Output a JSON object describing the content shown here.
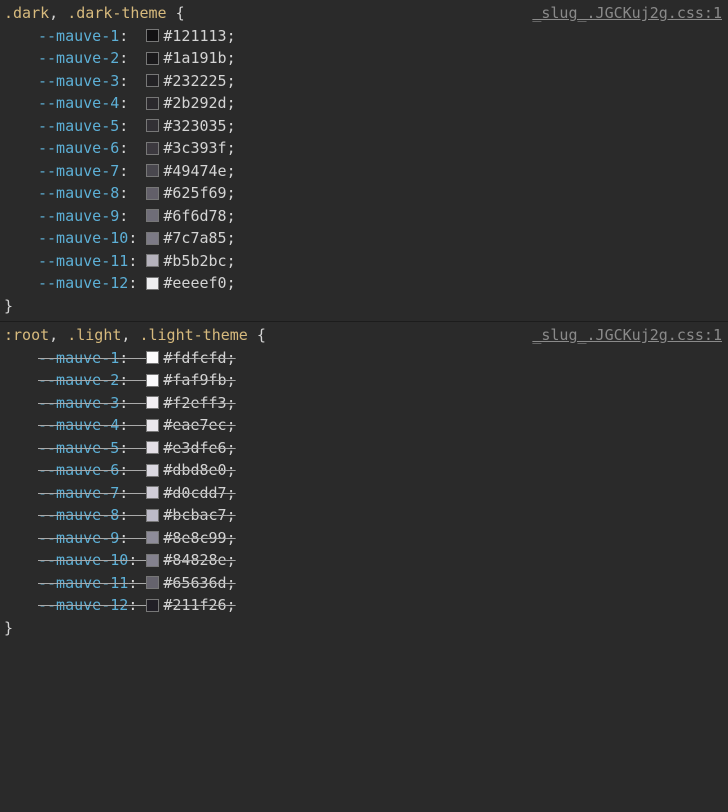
{
  "rules": [
    {
      "selector_parts": [
        {
          "t": ".dark",
          "c": "sel-class"
        },
        {
          "t": ", ",
          "c": "sel-punc"
        },
        {
          "t": ".dark-theme",
          "c": "sel-class"
        },
        {
          "t": " {",
          "c": "sel-punc"
        }
      ],
      "source": "_slug_.JGCKuj2g.css:1",
      "overridden": false,
      "decls": [
        {
          "name": "--mauve-1",
          "pad": " ",
          "value": "#121113",
          "swatch": "#121113"
        },
        {
          "name": "--mauve-2",
          "pad": " ",
          "value": "#1a191b",
          "swatch": "#1a191b"
        },
        {
          "name": "--mauve-3",
          "pad": " ",
          "value": "#232225",
          "swatch": "#232225"
        },
        {
          "name": "--mauve-4",
          "pad": " ",
          "value": "#2b292d",
          "swatch": "#2b292d"
        },
        {
          "name": "--mauve-5",
          "pad": " ",
          "value": "#323035",
          "swatch": "#323035"
        },
        {
          "name": "--mauve-6",
          "pad": " ",
          "value": "#3c393f",
          "swatch": "#3c393f"
        },
        {
          "name": "--mauve-7",
          "pad": " ",
          "value": "#49474e",
          "swatch": "#49474e"
        },
        {
          "name": "--mauve-8",
          "pad": " ",
          "value": "#625f69",
          "swatch": "#625f69"
        },
        {
          "name": "--mauve-9",
          "pad": " ",
          "value": "#6f6d78",
          "swatch": "#6f6d78"
        },
        {
          "name": "--mauve-10",
          "pad": "",
          "value": "#7c7a85",
          "swatch": "#7c7a85"
        },
        {
          "name": "--mauve-11",
          "pad": "",
          "value": "#b5b2bc",
          "swatch": "#b5b2bc"
        },
        {
          "name": "--mauve-12",
          "pad": "",
          "value": "#eeeef0",
          "swatch": "#eeeef0"
        }
      ],
      "close": "}"
    },
    {
      "selector_parts": [
        {
          "t": ":root",
          "c": "sel-class"
        },
        {
          "t": ", ",
          "c": "sel-punc"
        },
        {
          "t": ".light",
          "c": "sel-class"
        },
        {
          "t": ", ",
          "c": "sel-punc"
        },
        {
          "t": ".light-theme",
          "c": "sel-class"
        },
        {
          "t": " {",
          "c": "sel-punc"
        }
      ],
      "source": "_slug_.JGCKuj2g.css:1",
      "overridden": true,
      "decls": [
        {
          "name": "--mauve-1",
          "pad": " ",
          "value": "#fdfcfd",
          "swatch": "#fdfcfd"
        },
        {
          "name": "--mauve-2",
          "pad": " ",
          "value": "#faf9fb",
          "swatch": "#faf9fb"
        },
        {
          "name": "--mauve-3",
          "pad": " ",
          "value": "#f2eff3",
          "swatch": "#f2eff3"
        },
        {
          "name": "--mauve-4",
          "pad": " ",
          "value": "#eae7ec",
          "swatch": "#eae7ec"
        },
        {
          "name": "--mauve-5",
          "pad": " ",
          "value": "#e3dfe6",
          "swatch": "#e3dfe6"
        },
        {
          "name": "--mauve-6",
          "pad": " ",
          "value": "#dbd8e0",
          "swatch": "#dbd8e0"
        },
        {
          "name": "--mauve-7",
          "pad": " ",
          "value": "#d0cdd7",
          "swatch": "#d0cdd7"
        },
        {
          "name": "--mauve-8",
          "pad": " ",
          "value": "#bcbac7",
          "swatch": "#bcbac7"
        },
        {
          "name": "--mauve-9",
          "pad": " ",
          "value": "#8e8c99",
          "swatch": "#8e8c99"
        },
        {
          "name": "--mauve-10",
          "pad": "",
          "value": "#84828e",
          "swatch": "#84828e"
        },
        {
          "name": "--mauve-11",
          "pad": "",
          "value": "#65636d",
          "swatch": "#65636d"
        },
        {
          "name": "--mauve-12",
          "pad": "",
          "value": "#211f26",
          "swatch": "#211f26"
        }
      ],
      "close": "}"
    }
  ]
}
